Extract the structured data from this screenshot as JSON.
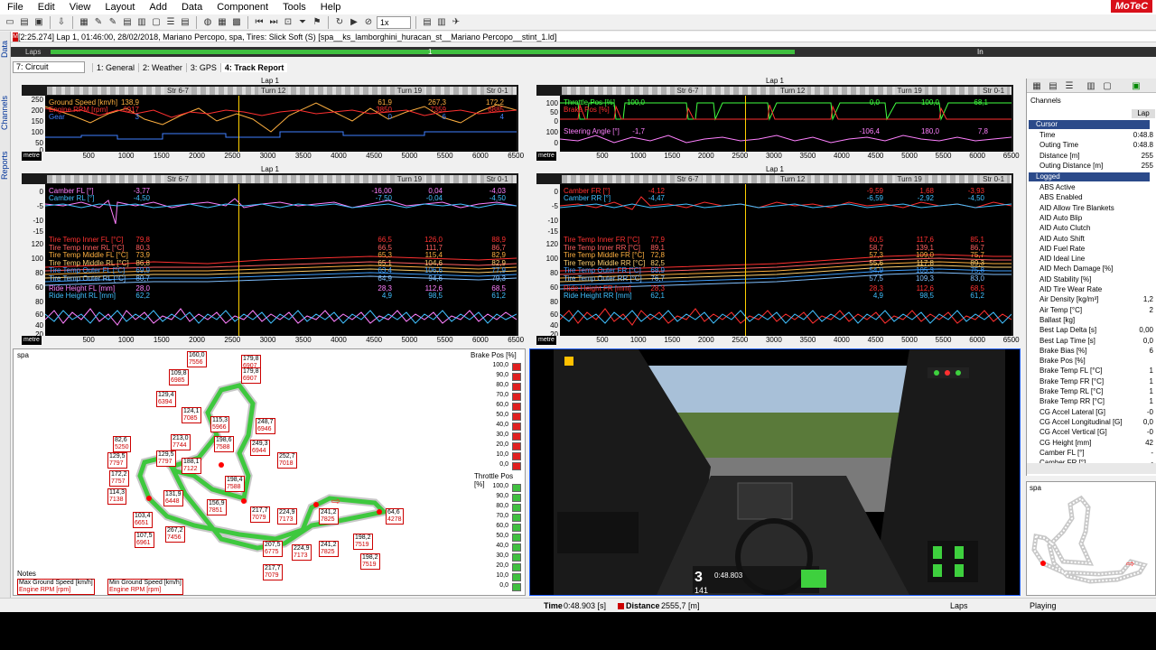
{
  "menu": [
    "File",
    "Edit",
    "View",
    "Layout",
    "Add",
    "Data",
    "Component",
    "Tools",
    "Help"
  ],
  "brand": "MoTeC",
  "toolbar": {
    "speed": "1x"
  },
  "sidetabs": {
    "data": "Data",
    "channels": "Channels",
    "reports": "Reports"
  },
  "infoline": "[2:25.274] Lap 1, 01:46:00, 28/02/2018, Mariano Percopo, spa, Tires: Slick Soft (S) [spa__ks_lamborghini_huracan_st__Mariano Percopo__stint_1.ld]",
  "laps_bar": {
    "label": "Laps",
    "mark1": "1",
    "mark2": "In"
  },
  "tabs": {
    "circuit": "7: Circuit",
    "items": [
      "1: General",
      "2: Weather",
      "3: GPS",
      "4: Track Report"
    ]
  },
  "x_ticks": [
    "500",
    "1000",
    "1500",
    "2000",
    "2500",
    "3000",
    "3500",
    "4000",
    "4500",
    "5000",
    "5500",
    "6000",
    "6500"
  ],
  "x_unit": "metre",
  "segments": [
    "Str 6-7",
    "Turn 12",
    "Turn 19",
    "Str 0-1"
  ],
  "lap_title": "Lap 1",
  "panel_tl": {
    "yticks": [
      "250",
      "200",
      "150",
      "100",
      "50",
      "0"
    ],
    "channels": [
      {
        "name": "Ground Speed [km/h]",
        "val": "138,9",
        "min": "61,9",
        "max": "267,3",
        "avg": "172,2",
        "color": "#ffb040"
      },
      {
        "name": "Engine RPM [rpm]",
        "val": "6917",
        "min": "3850",
        "max": "7359",
        "avg": "6885",
        "color": "#ff3030"
      },
      {
        "name": "Gear",
        "val": "3",
        "min": "0",
        "max": "6",
        "avg": "4",
        "color": "#4080ff"
      }
    ]
  },
  "panel_tr": {
    "yticks1": [
      "100",
      "50",
      "0"
    ],
    "yticks2": [
      "100",
      "0"
    ],
    "channels": [
      {
        "name": "Throttle Pos [%]",
        "val": "100,0",
        "min": "0,0",
        "max": "100,0",
        "avg": "68,1",
        "color": "#40ff40"
      },
      {
        "name": "Brake Pos [%]",
        "val": "0,0",
        "min": "0,0",
        "max": "100,0",
        "avg": "12,0",
        "color": "#ff3030"
      },
      {
        "name": "Steering Angle [°]",
        "val": "-1,7",
        "min": "-106,4",
        "max": "180,0",
        "avg": "7,8",
        "color": "#ff80ff"
      }
    ]
  },
  "panel_bl": {
    "yticks_camber": [
      "0",
      "-5",
      "-10",
      "-15"
    ],
    "yticks_temp": [
      "120",
      "100",
      "80",
      "60"
    ],
    "yticks_ride": [
      "80",
      "60",
      "40",
      "20"
    ],
    "camber": [
      {
        "name": "Camber FL [°]",
        "val": "-3,77",
        "min": "-16,00",
        "max": "0,04",
        "avg": "-4,03",
        "color": "#ff80ff"
      },
      {
        "name": "Camber RL [°]",
        "val": "-4,50",
        "min": "-7,50",
        "max": "-0,04",
        "avg": "-4,50",
        "color": "#40c0ff"
      }
    ],
    "temps": [
      {
        "name": "Tire Temp Inner FL [°C]",
        "val": "79,8",
        "min": "66,5",
        "max": "126,0",
        "avg": "88,9",
        "color": "#ff3030"
      },
      {
        "name": "Tire Temp Inner RL [°C]",
        "val": "80,3",
        "min": "66,5",
        "max": "111,7",
        "avg": "86,7",
        "color": "#ff6060"
      },
      {
        "name": "Tire Temp Middle FL [°C]",
        "val": "73,9",
        "min": "65,3",
        "max": "115,4",
        "avg": "82,9",
        "color": "#ffb040"
      },
      {
        "name": "Tire Temp Middle RL [°C]",
        "val": "86,8",
        "min": "65,1",
        "max": "104,6",
        "avg": "82,9",
        "color": "#ffd070"
      },
      {
        "name": "Tire Temp Outer FL [°C]",
        "val": "69,9",
        "min": "63,4",
        "max": "106,6",
        "avg": "77,9",
        "color": "#40a0ff"
      },
      {
        "name": "Tire Temp Outer RL [°C]",
        "val": "80,7",
        "min": "64,9",
        "max": "94,6",
        "avg": "79,3",
        "color": "#80c0ff"
      }
    ],
    "ride": [
      {
        "name": "Ride Height FL [mm]",
        "val": "28,0",
        "min": "28,3",
        "max": "112,6",
        "avg": "68,5",
        "color": "#ff80ff"
      },
      {
        "name": "Ride Height RL [mm]",
        "val": "62,2",
        "min": "4,9",
        "max": "98,5",
        "avg": "61,2",
        "color": "#40c0ff"
      }
    ]
  },
  "panel_br": {
    "yticks_camber": [
      "0",
      "-5",
      "-10",
      "-15"
    ],
    "yticks_temp": [
      "120",
      "100",
      "80",
      "60"
    ],
    "yticks_ride": [
      "80",
      "60",
      "40",
      "20"
    ],
    "camber": [
      {
        "name": "Camber FR [°]",
        "val": "-4,12",
        "min": "-9,59",
        "max": "1,68",
        "avg": "-3,93",
        "color": "#ff3030"
      },
      {
        "name": "Camber RR [°]",
        "val": "-4,47",
        "min": "-6,59",
        "max": "-2,92",
        "avg": "-4,50",
        "color": "#40c0ff"
      }
    ],
    "temps": [
      {
        "name": "Tire Temp Inner FR [°C]",
        "val": "77,9",
        "min": "60,5",
        "max": "117,6",
        "avg": "85,1",
        "color": "#ff3030"
      },
      {
        "name": "Tire Temp Inner RR [°C]",
        "val": "89,1",
        "min": "58,7",
        "max": "139,1",
        "avg": "86,7",
        "color": "#ff6060"
      },
      {
        "name": "Tire Temp Middle FR [°C]",
        "val": "72,8",
        "min": "57,3",
        "max": "109,0",
        "avg": "75,7",
        "color": "#ffb040"
      },
      {
        "name": "Tire Temp Middle RR [°C]",
        "val": "82,5",
        "min": "55,6",
        "max": "117,8",
        "avg": "89,3",
        "color": "#ffd070"
      },
      {
        "name": "Tire Temp Outer FR [°C]",
        "val": "68,9",
        "min": "54,9",
        "max": "105,3",
        "avg": "75,8",
        "color": "#40a0ff"
      },
      {
        "name": "Tire Temp Outer RR [°C]",
        "val": "76,7",
        "min": "57,5",
        "max": "109,3",
        "avg": "83,0",
        "color": "#80c0ff"
      }
    ],
    "ride": [
      {
        "name": "Ride Height FR [mm]",
        "val": "28,3",
        "min": "28,3",
        "max": "112,6",
        "avg": "68,5",
        "color": "#ff3030"
      },
      {
        "name": "Ride Height RR [mm]",
        "val": "62,1",
        "min": "4,9",
        "max": "98,5",
        "avg": "61,2",
        "color": "#40c0ff"
      }
    ]
  },
  "trackmap": {
    "title": "spa",
    "notes": "Notes",
    "legend": [
      {
        "a": "Max Ground Speed [km/h]",
        "b": "Engine RPM [rpm]"
      },
      {
        "a": "Min Ground Speed [km/h]",
        "b": "Engine RPM [rpm]"
      }
    ],
    "labels": [
      {
        "a": "160,0",
        "b": "7556"
      },
      {
        "a": "179,8",
        "b": "6907"
      },
      {
        "a": "179,8",
        "b": "6907"
      },
      {
        "a": "109,8",
        "b": "6985"
      },
      {
        "a": "129,4",
        "b": "6394"
      },
      {
        "a": "124,1",
        "b": "7085"
      },
      {
        "a": "115,3",
        "b": "5966"
      },
      {
        "a": "248,7",
        "b": "6946"
      },
      {
        "a": "213,0",
        "b": "7744"
      },
      {
        "a": "198,6",
        "b": "7588"
      },
      {
        "a": "249,3",
        "b": "6944"
      },
      {
        "a": "252,7",
        "b": "7018"
      },
      {
        "a": "82,6",
        "b": "5250"
      },
      {
        "a": "129,5",
        "b": "7797"
      },
      {
        "a": "129,5",
        "b": "7797"
      },
      {
        "a": "188,1",
        "b": "7122"
      },
      {
        "a": "172,2",
        "b": "7757"
      },
      {
        "a": "198,4",
        "b": "7588"
      },
      {
        "a": "114,3",
        "b": "7138"
      },
      {
        "a": "131,9",
        "b": "6448"
      },
      {
        "a": "156,9",
        "b": "7851"
      },
      {
        "a": "217,7",
        "b": "7079"
      },
      {
        "a": "224,9",
        "b": "7173"
      },
      {
        "a": "241,2",
        "b": "7825"
      },
      {
        "a": "64,6",
        "b": "4278"
      },
      {
        "a": "103,4",
        "b": "6651"
      },
      {
        "a": "267,2",
        "b": "7456"
      },
      {
        "a": "107,5",
        "b": "6961"
      },
      {
        "a": "207,5",
        "b": "6775"
      },
      {
        "a": "224,9",
        "b": "7173"
      },
      {
        "a": "241,2",
        "b": "7825"
      },
      {
        "a": "198,2",
        "b": "7519"
      },
      {
        "a": "198,2",
        "b": "7519"
      },
      {
        "a": "217,7",
        "b": "7079"
      }
    ],
    "brake_title": "Brake Pos [%]",
    "throttle_title": "Throttle Pos [%]",
    "scale": [
      "100,0",
      "90,0",
      "80,0",
      "70,0",
      "60,0",
      "50,0",
      "40,0",
      "30,0",
      "20,0",
      "10,0",
      "0,0"
    ]
  },
  "video": {
    "position": "3",
    "position_of": "141",
    "laptime": "0:48.803"
  },
  "channels_panel": {
    "title": "Channels",
    "tab": "Lap",
    "cursor_group": "Cursor",
    "cursor_rows": [
      {
        "n": "Time",
        "v": "0:48.8"
      },
      {
        "n": "Outing Time",
        "v": "0:48.8"
      },
      {
        "n": "Distance [m]",
        "v": "255"
      },
      {
        "n": "Outing Distance [m]",
        "v": "255"
      }
    ],
    "logged_group": "Logged",
    "logged_rows": [
      {
        "n": "ABS Active",
        "v": ""
      },
      {
        "n": "ABS Enabled",
        "v": ""
      },
      {
        "n": "AID Allow Tire Blankets",
        "v": ""
      },
      {
        "n": "AID Auto Blip",
        "v": ""
      },
      {
        "n": "AID Auto Clutch",
        "v": ""
      },
      {
        "n": "AID Auto Shift",
        "v": ""
      },
      {
        "n": "AID Fuel Rate",
        "v": ""
      },
      {
        "n": "AID Ideal Line",
        "v": ""
      },
      {
        "n": "AID Mech Damage [%]",
        "v": ""
      },
      {
        "n": "AID Stability [%]",
        "v": ""
      },
      {
        "n": "AID Tire Wear Rate",
        "v": ""
      },
      {
        "n": "Air Density [kg/m³]",
        "v": "1,2"
      },
      {
        "n": "Air Temp [°C]",
        "v": "2"
      },
      {
        "n": "Ballast [kg]",
        "v": ""
      },
      {
        "n": "Best Lap Delta [s]",
        "v": "0,00"
      },
      {
        "n": "Best Lap Time [s]",
        "v": "0,0"
      },
      {
        "n": "Brake Bias [%]",
        "v": "6"
      },
      {
        "n": "Brake Pos [%]",
        "v": ""
      },
      {
        "n": "Brake Temp FL [°C]",
        "v": "1"
      },
      {
        "n": "Brake Temp FR [°C]",
        "v": "1"
      },
      {
        "n": "Brake Temp RL [°C]",
        "v": "1"
      },
      {
        "n": "Brake Temp RR [°C]",
        "v": "1"
      },
      {
        "n": "CG Accel Lateral [G]",
        "v": "-0"
      },
      {
        "n": "CG Accel Longitudinal [G]",
        "v": "0,0"
      },
      {
        "n": "CG Accel Vertical [G]",
        "v": "-0"
      },
      {
        "n": "CG Height [mm]",
        "v": "42"
      },
      {
        "n": "Camber FL [°]",
        "v": "-"
      },
      {
        "n": "Camber FR [°]",
        "v": "-"
      }
    ]
  },
  "minimap_title": "spa",
  "status": {
    "time_label": "Time",
    "time_val": "0:48.903 [s]",
    "dist_label": "Distance",
    "dist_val": "2555,7 [m]",
    "laps": "Laps",
    "playing": "Playing"
  }
}
